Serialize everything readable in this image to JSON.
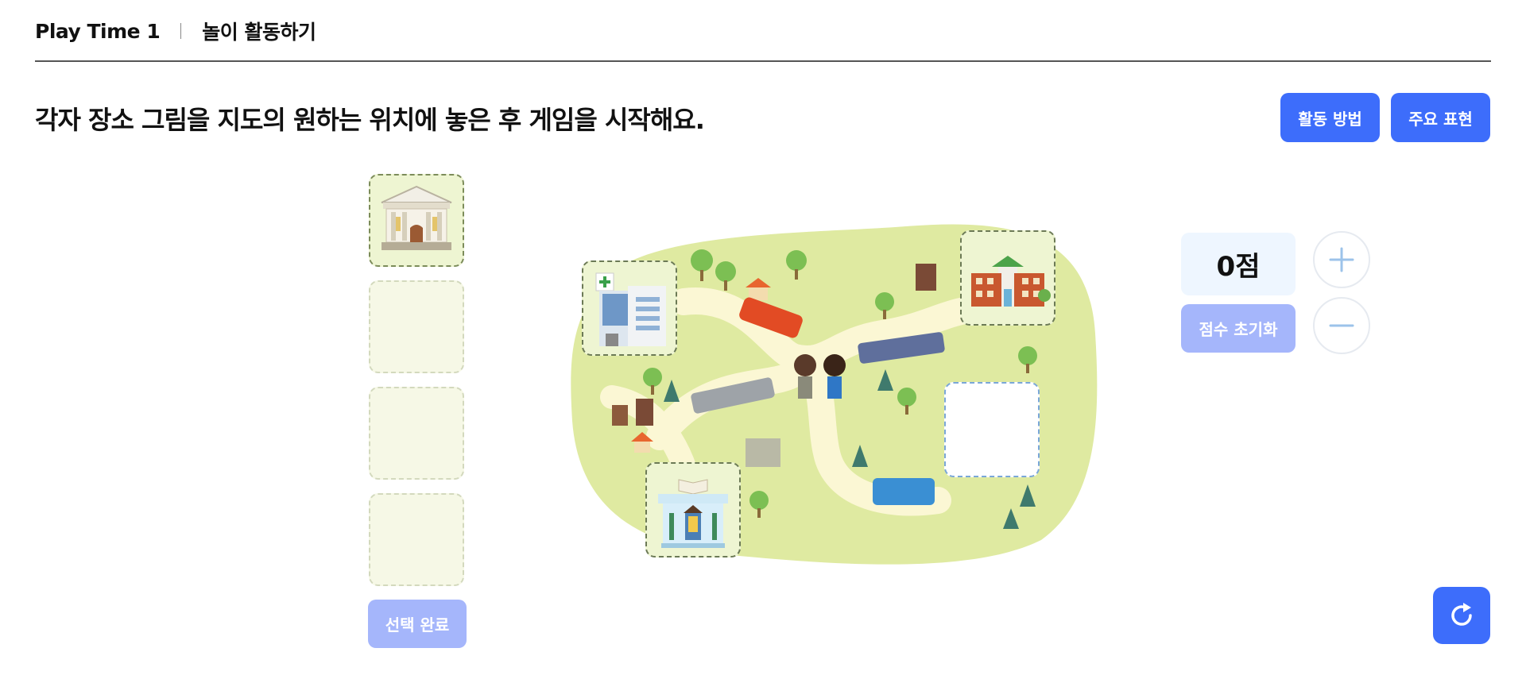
{
  "header": {
    "lesson": "Play Time 1",
    "activity": "놀이 활동하기"
  },
  "instruction": "각자 장소 그림을 지도의 원하는 위치에 놓은 후 게임을 시작해요.",
  "buttons": {
    "how": "활동 방법",
    "expressions": "주요 표현",
    "done": "선택 완료",
    "reset_score": "점수 초기화"
  },
  "score": {
    "display": "0점",
    "value": 0
  },
  "slots": [
    {
      "content": "museum-icon",
      "filled": true
    },
    {
      "content": "",
      "filled": false
    },
    {
      "content": "",
      "filled": false
    },
    {
      "content": "",
      "filled": false
    }
  ],
  "map_places": [
    "hospital-icon",
    "school-icon",
    "bookstore-icon",
    "empty-drop-zone"
  ],
  "colors": {
    "accent": "#3d6dfb",
    "accent_disabled": "#a5b6fb",
    "map_green": "#dfeaa1",
    "road": "#fbf7d4"
  }
}
